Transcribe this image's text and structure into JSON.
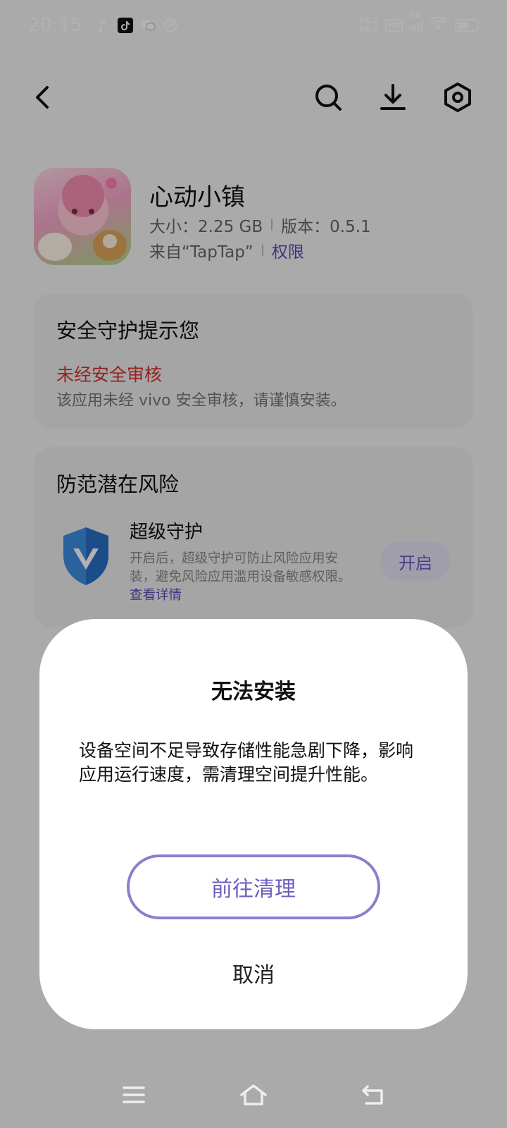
{
  "status_bar": {
    "time": "20:15",
    "net_speed_value": "15.2",
    "net_speed_unit": "KB/s",
    "hd": "HD",
    "network": "5G",
    "icons": [
      "music-note-icon",
      "tiktok-icon",
      "wechat-icon",
      "link-app-icon",
      "signal-icon",
      "wifi-icon",
      "battery-icon"
    ]
  },
  "toolbar": {
    "icons": [
      "back-arrow-icon",
      "search-icon",
      "download-icon",
      "settings-hexagon-icon"
    ]
  },
  "app": {
    "name": "心动小镇",
    "size": "大小：2.25 GB",
    "version": "版本：0.5.1",
    "source": "来自“TapTap”",
    "permissions_link": "权限"
  },
  "security_card": {
    "title": "安全守护提示您",
    "risk_title": "未经安全审核",
    "risk_desc": "该应用未经 vivo 安全审核，请谨慎安装。"
  },
  "risk_card": {
    "title": "防范潜在风险",
    "guard_name": "超级守护",
    "guard_desc": "开启后，超级守护可防止风险应用安装，避免风险应用滥用设备敏感权限。",
    "guard_link": "查看详情",
    "enable_label": "开启"
  },
  "dialog": {
    "title": "无法安装",
    "message": "设备空间不足导致存储性能急剧下降，影响应用运行速度，需清理空间提升性能。",
    "primary_label": "前往清理",
    "cancel_label": "取消"
  },
  "nav": {
    "icons": [
      "menu-icon",
      "home-icon",
      "back-icon"
    ]
  },
  "colors": {
    "accent": "#6b5fc0",
    "warning": "#d8312f",
    "overlay": "rgba(0,0,0,0.30)"
  }
}
